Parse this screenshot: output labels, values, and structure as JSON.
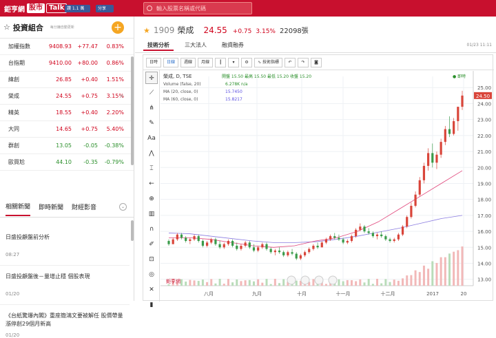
{
  "header": {
    "logo_a": "鉅亨網",
    "logo_b": "股市",
    "logo_c": "Talk",
    "like_label": "讚 1.1 萬",
    "share_label": "分享",
    "search_placeholder": "輸入股票名稱或代碼",
    "brand_color": "#c8102e"
  },
  "watchlist": {
    "title": "投資組合",
    "subtitle": "每分鐘自動更新",
    "add_label": "+",
    "rows": [
      {
        "name": "加權指數",
        "price": "9408.93",
        "change": "+77.47",
        "pct": "0.83%",
        "dir": "up"
      },
      {
        "name": "台指期",
        "price": "9410.00",
        "change": "+80.00",
        "pct": "0.86%",
        "dir": "up"
      },
      {
        "name": "緯創",
        "price": "26.85",
        "change": "+0.40",
        "pct": "1.51%",
        "dir": "up"
      },
      {
        "name": "榮成",
        "price": "24.55",
        "change": "+0.75",
        "pct": "3.15%",
        "dir": "up",
        "close": "×"
      },
      {
        "name": "精英",
        "price": "18.55",
        "change": "+0.40",
        "pct": "2.20%",
        "dir": "up"
      },
      {
        "name": "大同",
        "price": "14.65",
        "change": "+0.75",
        "pct": "5.40%",
        "dir": "up"
      },
      {
        "name": "群創",
        "price": "13.05",
        "change": "-0.05",
        "pct": "-0.38%",
        "dir": "dn"
      },
      {
        "name": "歐買尬",
        "price": "44.10",
        "change": "-0.35",
        "pct": "-0.79%",
        "dir": "dn"
      }
    ]
  },
  "news": {
    "tabs": [
      "相關新聞",
      "即時新聞",
      "財經影音"
    ],
    "items": [
      {
        "title": "日盛投顧盤前分析",
        "time": "08:27"
      },
      {
        "title": "日盛投顧盤後－量增止穩 個股表現",
        "time": "01/20"
      },
      {
        "title": "《台紙驚爆內閣》重座簡鴻文要被解任 股價帶量漲停創29個月新高",
        "time": "01/20"
      }
    ]
  },
  "stock": {
    "code": "1909",
    "name": "榮成",
    "price": "24.55",
    "change": "+0.75",
    "pct": "3.15%",
    "volume": "22098張"
  },
  "tabs": [
    "技術分析",
    "三大法人",
    "融資融券"
  ],
  "updated": "01/23 11:11",
  "chart_toolbar": [
    "日時",
    "日線",
    "週線",
    "月線",
    "技術指標"
  ],
  "chart_legend": {
    "title": "榮成, D, TSE",
    "ohlc": "開盤 15.50 最高 15.50 最低 15.20 收盤 15.20",
    "vol": "Volume (false, 20)",
    "vol_val": "6.278K n/a",
    "ma20": "MA (20, close, 0)",
    "ma20_val": "15.7450",
    "ma60": "MA (60, close, 0)",
    "ma60_val": "15.8217",
    "live": "● 即時"
  },
  "chart_data": {
    "type": "candlestick",
    "title": "榮成, D, TSE",
    "x_labels": [
      "八月",
      "九月",
      "十月",
      "十一月",
      "十二月",
      "2017",
      "20"
    ],
    "y_ticks": [
      25,
      24,
      23,
      22,
      21,
      20,
      19,
      18,
      17,
      16,
      15,
      14,
      13
    ],
    "ylim": [
      12.6,
      25.7
    ],
    "last_price_label": "24.50",
    "ohlc": [
      [
        15.4,
        15.5,
        15.1,
        15.2
      ],
      [
        15.2,
        15.6,
        15.2,
        15.5
      ],
      [
        15.5,
        15.9,
        15.4,
        15.8
      ],
      [
        15.8,
        15.9,
        15.5,
        15.6
      ],
      [
        15.6,
        15.7,
        15.3,
        15.4
      ],
      [
        15.4,
        15.6,
        15.2,
        15.5
      ],
      [
        15.5,
        15.8,
        15.4,
        15.7
      ],
      [
        15.7,
        15.8,
        15.3,
        15.4
      ],
      [
        15.4,
        15.5,
        15.0,
        15.1
      ],
      [
        15.1,
        15.4,
        15.0,
        15.3
      ],
      [
        15.3,
        15.6,
        15.2,
        15.5
      ],
      [
        15.5,
        15.6,
        15.1,
        15.2
      ],
      [
        15.2,
        15.4,
        14.9,
        15.0
      ],
      [
        15.0,
        15.3,
        14.9,
        15.2
      ],
      [
        15.2,
        15.5,
        15.1,
        15.4
      ],
      [
        15.4,
        15.5,
        15.0,
        15.1
      ],
      [
        15.1,
        15.3,
        14.8,
        14.9
      ],
      [
        14.9,
        15.2,
        14.8,
        15.1
      ],
      [
        15.1,
        15.4,
        15.0,
        15.3
      ],
      [
        15.3,
        15.4,
        14.9,
        15.0
      ],
      [
        15.0,
        15.2,
        14.7,
        14.8
      ],
      [
        14.8,
        15.1,
        14.7,
        15.0
      ],
      [
        15.0,
        15.3,
        14.9,
        15.2
      ],
      [
        15.2,
        15.3,
        14.8,
        14.9
      ],
      [
        14.9,
        15.0,
        14.6,
        14.7
      ],
      [
        14.7,
        14.9,
        14.5,
        14.8
      ],
      [
        14.8,
        15.0,
        14.6,
        14.7
      ],
      [
        14.7,
        14.8,
        14.4,
        14.5
      ],
      [
        14.5,
        14.8,
        14.4,
        14.7
      ],
      [
        14.7,
        14.9,
        14.5,
        14.6
      ],
      [
        14.6,
        14.7,
        14.2,
        14.3
      ],
      [
        14.3,
        14.6,
        14.2,
        14.5
      ],
      [
        14.5,
        14.8,
        14.4,
        14.7
      ],
      [
        14.7,
        15.0,
        14.6,
        14.9
      ],
      [
        14.9,
        15.2,
        14.8,
        15.1
      ],
      [
        15.1,
        15.3,
        14.9,
        15.0
      ],
      [
        15.0,
        15.4,
        15.0,
        15.3
      ],
      [
        15.3,
        15.6,
        15.2,
        15.5
      ],
      [
        15.5,
        15.8,
        15.4,
        15.7
      ],
      [
        15.7,
        15.9,
        15.5,
        15.6
      ],
      [
        15.6,
        15.8,
        15.4,
        15.5
      ],
      [
        15.5,
        15.6,
        15.2,
        15.3
      ],
      [
        15.3,
        15.5,
        15.2,
        15.4
      ],
      [
        15.4,
        15.8,
        15.3,
        15.7
      ],
      [
        15.7,
        16.2,
        15.6,
        16.1
      ],
      [
        16.1,
        16.5,
        16.0,
        16.3
      ],
      [
        16.3,
        16.4,
        15.9,
        16.0
      ],
      [
        16.0,
        16.2,
        15.8,
        15.9
      ],
      [
        15.9,
        16.0,
        15.6,
        15.7
      ],
      [
        15.7,
        15.9,
        15.5,
        15.8
      ],
      [
        15.8,
        16.0,
        15.6,
        15.7
      ],
      [
        15.7,
        15.8,
        15.4,
        15.5
      ],
      [
        15.5,
        15.6,
        15.3,
        15.4
      ],
      [
        15.4,
        15.6,
        15.3,
        15.5
      ],
      [
        15.5,
        15.9,
        15.4,
        15.8
      ],
      [
        15.8,
        16.4,
        15.7,
        16.3
      ],
      [
        16.3,
        17.0,
        16.2,
        16.9
      ],
      [
        16.9,
        17.8,
        16.8,
        17.6
      ],
      [
        17.6,
        18.5,
        17.5,
        18.3
      ],
      [
        18.3,
        19.4,
        18.2,
        19.2
      ],
      [
        19.2,
        20.3,
        19.0,
        20.1
      ],
      [
        20.1,
        21.2,
        19.8,
        20.9
      ],
      [
        20.9,
        21.5,
        20.0,
        20.3
      ],
      [
        20.3,
        21.0,
        19.9,
        20.8
      ],
      [
        20.8,
        21.8,
        20.6,
        21.6
      ],
      [
        21.6,
        22.6,
        21.4,
        22.4
      ],
      [
        22.4,
        23.2,
        21.9,
        22.1
      ],
      [
        22.1,
        23.1,
        22.0,
        22.9
      ],
      [
        22.9,
        23.6,
        22.3,
        23.8
      ],
      [
        23.8,
        24.8,
        23.6,
        24.5
      ]
    ],
    "ma20": [
      15.6,
      15.6,
      15.5,
      15.3,
      15.1,
      15.0,
      15.1,
      15.4,
      15.6,
      16.0,
      16.6,
      17.4,
      18.2,
      19.0,
      19.8
    ],
    "ma60": [
      15.9,
      15.85,
      15.7,
      15.55,
      15.4,
      15.3,
      15.3,
      15.35,
      15.5,
      15.7,
      15.95,
      16.2,
      16.5,
      16.8,
      17.0
    ],
    "volume_note": "volume bars shown at bottom, rising strongly in January"
  }
}
